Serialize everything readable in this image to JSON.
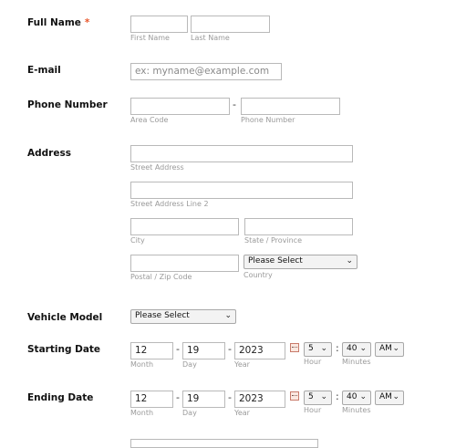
{
  "full_name": {
    "label": "Full Name",
    "required_mark": "*",
    "first_sub": "First Name",
    "last_sub": "Last Name"
  },
  "email": {
    "label": "E-mail",
    "placeholder": "ex: myname@example.com"
  },
  "phone": {
    "label": "Phone Number",
    "dash": "-",
    "area_sub": "Area Code",
    "number_sub": "Phone Number"
  },
  "address": {
    "label": "Address",
    "street_sub": "Street Address",
    "street2_sub": "Street Address Line 2",
    "city_sub": "City",
    "state_sub": "State / Province",
    "postal_sub": "Postal / Zip Code",
    "country_select": "Please Select",
    "country_sub": "Country"
  },
  "vehicle": {
    "label": "Vehicle Model",
    "select": "Please Select"
  },
  "starting_date": {
    "label": "Starting Date",
    "month": "12",
    "day": "19",
    "year": "2023",
    "dash": "-",
    "month_sub": "Month",
    "day_sub": "Day",
    "year_sub": "Year",
    "hour": "5",
    "colon": ":",
    "minutes": "40",
    "ampm": "AM",
    "hour_sub": "Hour",
    "minutes_sub": "Minutes"
  },
  "ending_date": {
    "label": "Ending Date",
    "month": "12",
    "day": "19",
    "year": "2023",
    "dash": "-",
    "month_sub": "Month",
    "day_sub": "Day",
    "year_sub": "Year",
    "hour": "5",
    "colon": ":",
    "minutes": "40",
    "ampm": "AM",
    "hour_sub": "Hour",
    "minutes_sub": "Minutes"
  },
  "icons": {
    "calendar": "calendar-icon",
    "caret": "chevron-down-icon"
  }
}
